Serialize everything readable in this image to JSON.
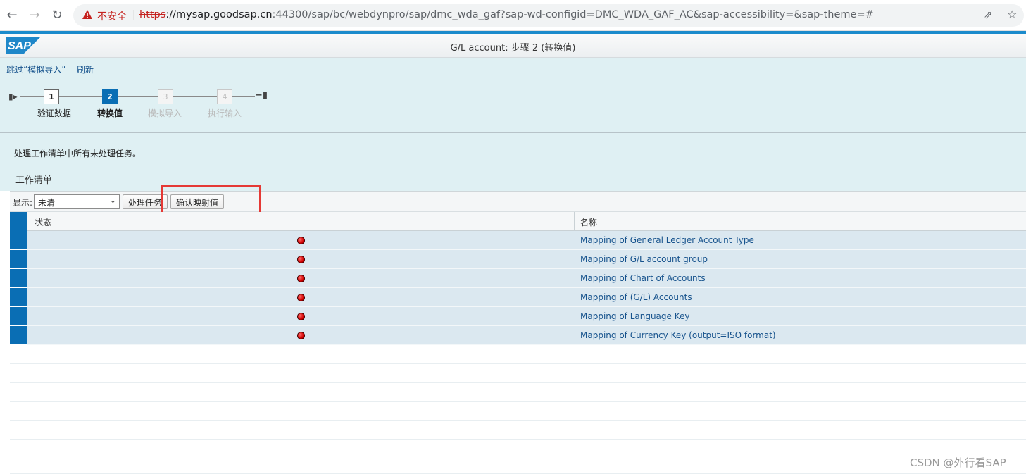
{
  "browser": {
    "back_icon": "arrow-left-icon",
    "forward_icon": "arrow-right-icon",
    "reload_icon": "reload-icon",
    "insecure_label": "不安全",
    "url_scheme": "https",
    "url_host": "://mysap.goodsap.cn",
    "url_rest": ":44300/sap/bc/webdynpro/sap/dmc_wda_gaf?sap-wd-configid=DMC_WDA_GAF_AC&sap-accessibility=&sap-theme=#",
    "share_icon": "share-icon",
    "star_icon": "star-icon"
  },
  "header": {
    "logo_text": "SAP",
    "title": "G/L account: 步骤 2  (转换值)"
  },
  "toolbar_links": {
    "skip": "跳过“模拟导入”",
    "refresh": "刷新"
  },
  "roadmap": {
    "steps": [
      {
        "num": "1",
        "label": "验证数据",
        "state": "done"
      },
      {
        "num": "2",
        "label": "转换值",
        "state": "active"
      },
      {
        "num": "3",
        "label": "模拟导入",
        "state": "disabled"
      },
      {
        "num": "4",
        "label": "执行输入",
        "state": "disabled"
      }
    ]
  },
  "main": {
    "message": "处理工作清单中所有未处理任务。",
    "worklist_title": "工作清单"
  },
  "worklist_toolbar": {
    "show_label": "显示:",
    "filter_value": "未清",
    "process_button": "处理任务",
    "confirm_button": "确认映射值"
  },
  "table": {
    "columns": [
      "状态",
      "名称"
    ],
    "rows": [
      {
        "status": "red",
        "name": "Mapping of General Ledger Account Type"
      },
      {
        "status": "red",
        "name": "Mapping of G/L account group"
      },
      {
        "status": "red",
        "name": "Mapping of Chart of Accounts"
      },
      {
        "status": "red",
        "name": "Mapping of (G/L) Accounts"
      },
      {
        "status": "red",
        "name": "Mapping of Language Key"
      },
      {
        "status": "red",
        "name": "Mapping of Currency Key (output=ISO format)"
      }
    ]
  },
  "watermark": "CSDN @外行看SAP",
  "colors": {
    "accent": "#0a6eb4",
    "link": "#17538d",
    "panel": "#dff0f3",
    "alert": "#e53935"
  }
}
